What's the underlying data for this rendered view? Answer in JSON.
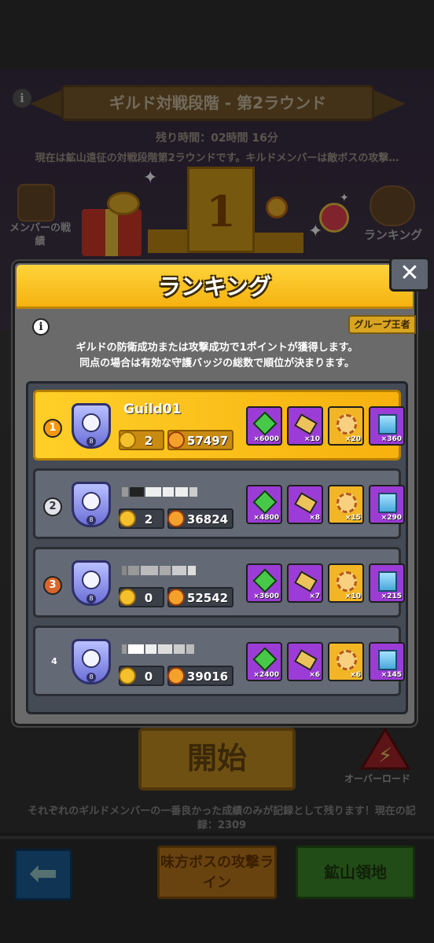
{
  "background": {
    "title": "ギルド対戦段階 - 第2ラウンド",
    "remaining_time": "残り時間：02時間 16分",
    "description": "現在は鉱山遠征の対戦段階第2ラウンドです。キルドメンバーは敵ボスの攻撃…ください",
    "member_record_label": "メンバーの戦績",
    "ranking_label": "ランキング",
    "start_button": "開始",
    "overload_label": "オーバーロード",
    "note": "それぞれのギルドメンバーの一番良かった成績のみが記録として残ります！現在の記録：2309",
    "attack_line_button": "味方ボスの攻撃ライン",
    "mine_button": "鉱山領地",
    "back_icon": "back-arrow-icon"
  },
  "modal": {
    "title": "ランキング",
    "close_label": "✕",
    "group_tag": "グループ王者",
    "description_line1": "ギルドの防衛成功または攻撃成功で1ポイントが獲得します。",
    "description_line2": "同点の場合は有効な守護バッジの総数で順位が決まります。"
  },
  "rankings": [
    {
      "rank": "1",
      "name": "Guild01",
      "points": "2",
      "power": "57497",
      "items": [
        "×6000",
        "×10",
        "×20",
        "×360"
      ]
    },
    {
      "rank": "2",
      "name": "",
      "points": "2",
      "power": "36824",
      "items": [
        "×4800",
        "×8",
        "×15",
        "×290"
      ]
    },
    {
      "rank": "3",
      "name": "",
      "points": "0",
      "power": "52542",
      "items": [
        "×3600",
        "×7",
        "×10",
        "×215"
      ]
    },
    {
      "rank": "4",
      "name": "",
      "points": "0",
      "power": "39016",
      "items": [
        "×2400",
        "×6",
        "×6",
        "×145"
      ]
    }
  ],
  "colors": {
    "header_yellow": "#ffd43a",
    "first_row": "#f7b10e",
    "row_gray": "#636a75",
    "close_button": "#5e6470"
  }
}
